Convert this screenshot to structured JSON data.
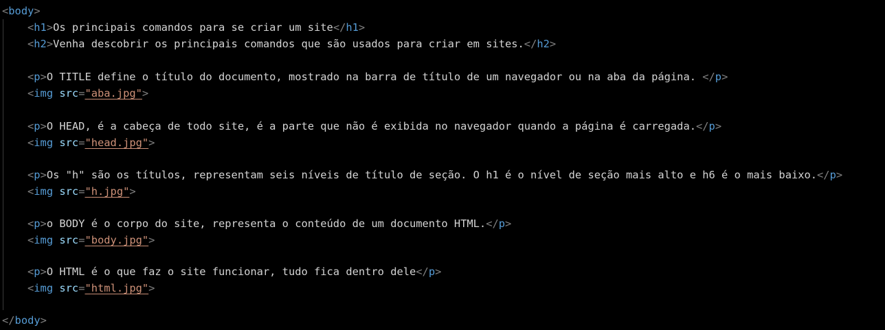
{
  "code": {
    "body_tag": "body",
    "h1": {
      "tag": "h1",
      "text": "Os principais comandos para se criar um site"
    },
    "h2": {
      "tag": "h2",
      "text": "Venha descobrir os principais comandos que são usados para criar em sites."
    },
    "blocks": [
      {
        "p_text": "O TITLE define o título do documento, mostrado na barra de título de um navegador ou na aba da página. ",
        "img_src": "aba.jpg"
      },
      {
        "p_text": "O HEAD, é a cabeça de todo site, é a parte que não é exibida no navegador quando a página é carregada.",
        "img_src": "head.jpg"
      },
      {
        "p_text": "Os \"h\" são os títulos, representam seis níveis de título de seção. O h1 é o nível de seção mais alto e h6 é o mais baixo.",
        "img_src": "h.jpg"
      },
      {
        "p_text": "o BODY é o corpo do site, representa o conteúdo de um documento HTML.",
        "img_src": "body.jpg"
      },
      {
        "p_text": "O HTML é o que faz o site funcionar, tudo fica dentro dele",
        "img_src": "html.jpg"
      }
    ],
    "p_tag": "p",
    "img_tag": "img",
    "src_attr": "src"
  },
  "colors": {
    "background": "#000000",
    "tag": "#569cd6",
    "punctuation": "#808080",
    "attribute": "#9cdcfe",
    "string": "#ce9178",
    "text": "#d4d4d4"
  }
}
